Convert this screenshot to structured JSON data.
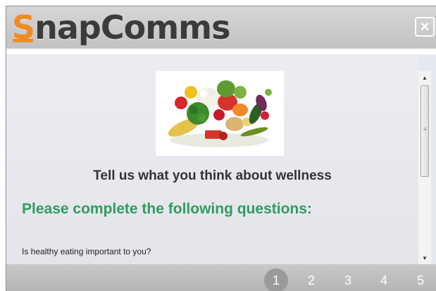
{
  "header": {
    "logo_first": "S",
    "logo_rest": "napComms",
    "close_label": "×"
  },
  "content": {
    "image_icon": "vegetables-image",
    "title": "Tell us what you think about wellness",
    "heading": "Please complete the following questions:",
    "question": "Is healthy eating important to you?"
  },
  "pager": {
    "pages": [
      "1",
      "2",
      "3",
      "4",
      "5"
    ],
    "active": "1"
  },
  "colors": {
    "brand_orange": "#f08a24",
    "heading_green": "#2f9c5e"
  }
}
